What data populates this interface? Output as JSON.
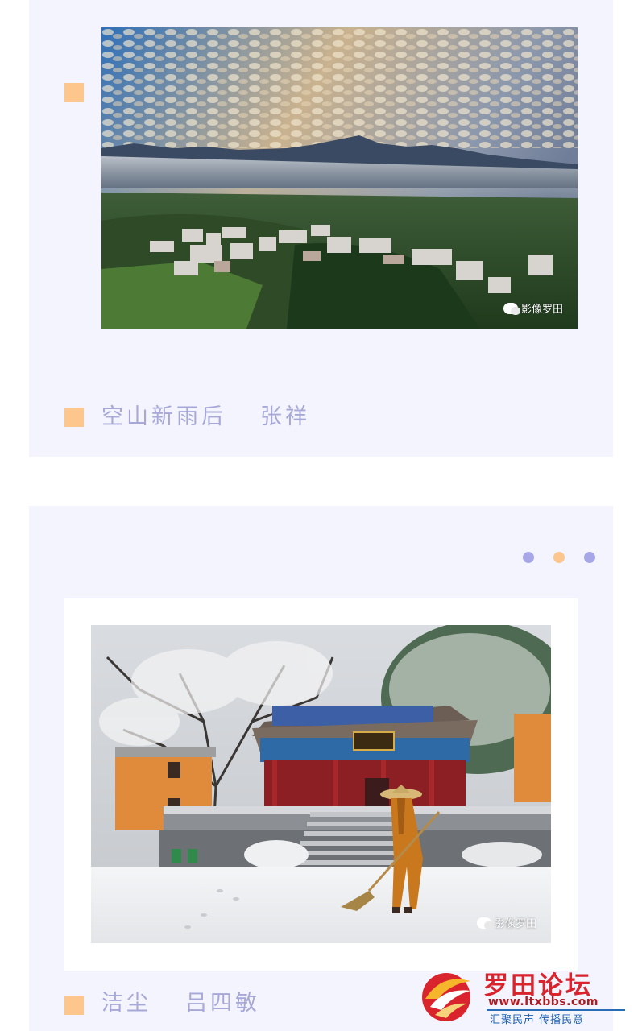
{
  "posts": [
    {
      "caption_title": "空山新雨后",
      "caption_author": "张祥",
      "watermark": "影像罗田"
    },
    {
      "caption_title": "洁尘",
      "caption_author": "吕四敏",
      "watermark": "影像罗田"
    }
  ],
  "logo": {
    "title": "罗田论坛",
    "url": "www.ltxbbs.com",
    "slogan": "汇聚民声  传播民意"
  },
  "colors": {
    "card_bg": "#f3f4fd",
    "accent_orange": "#fcc68c",
    "accent_purple": "#a7a7e8",
    "caption_text": "#a7a7d8",
    "logo_red": "#d9232d",
    "logo_blue": "#1d5fae"
  },
  "icons": [
    "wechat-icon",
    "forum-logo-icon"
  ]
}
